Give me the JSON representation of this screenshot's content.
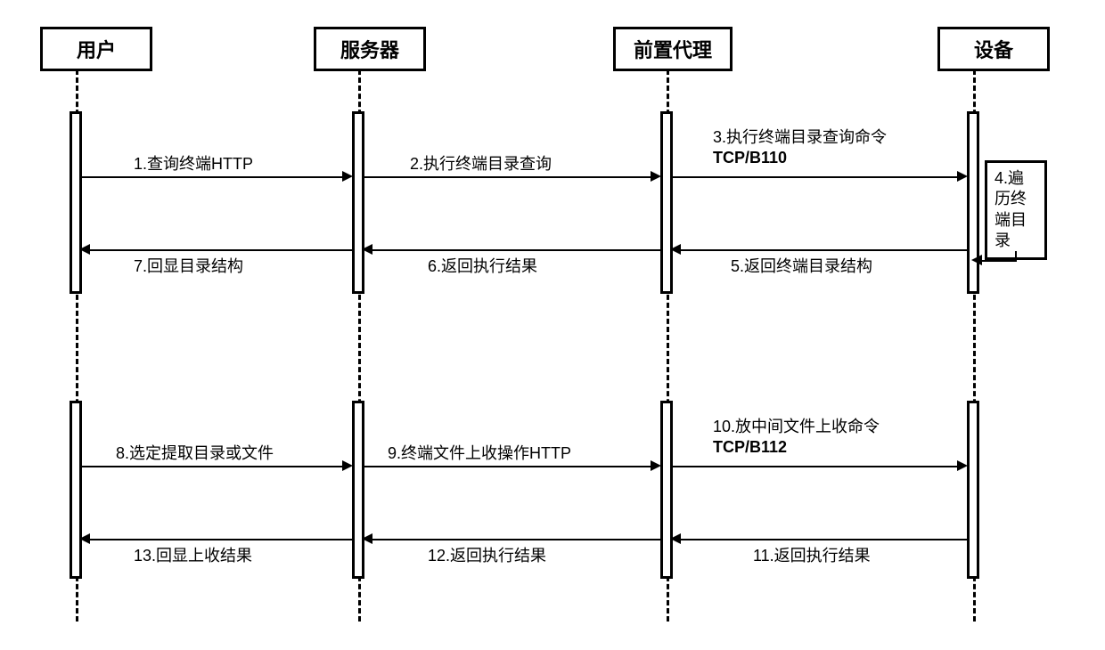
{
  "participants": {
    "user": "用户",
    "server": "服务器",
    "proxy": "前置代理",
    "device": "设备"
  },
  "messages": {
    "m1": "1.查询终端HTTP",
    "m2": "2.执行终端目录查询",
    "m3a": "3.执行终端目录查询命令",
    "m3b": "TCP/B110",
    "m4": "4.遍历终端目录",
    "m5": "5.返回终端目录结构",
    "m6": "6.返回执行结果",
    "m7": "7.回显目录结构",
    "m8": "8.选定提取目录或文件",
    "m9": "9.终端文件上收操作HTTP",
    "m10a": "10.放中间文件上收命令",
    "m10b": "TCP/B112",
    "m11": "11.返回执行结果",
    "m12": "12.返回执行结果",
    "m13": "13.回显上收结果"
  },
  "layout": {
    "cols": {
      "user": 55,
      "server": 372,
      "proxy": 718,
      "device": 1062
    },
    "note": "x positions are lifeline centers"
  }
}
